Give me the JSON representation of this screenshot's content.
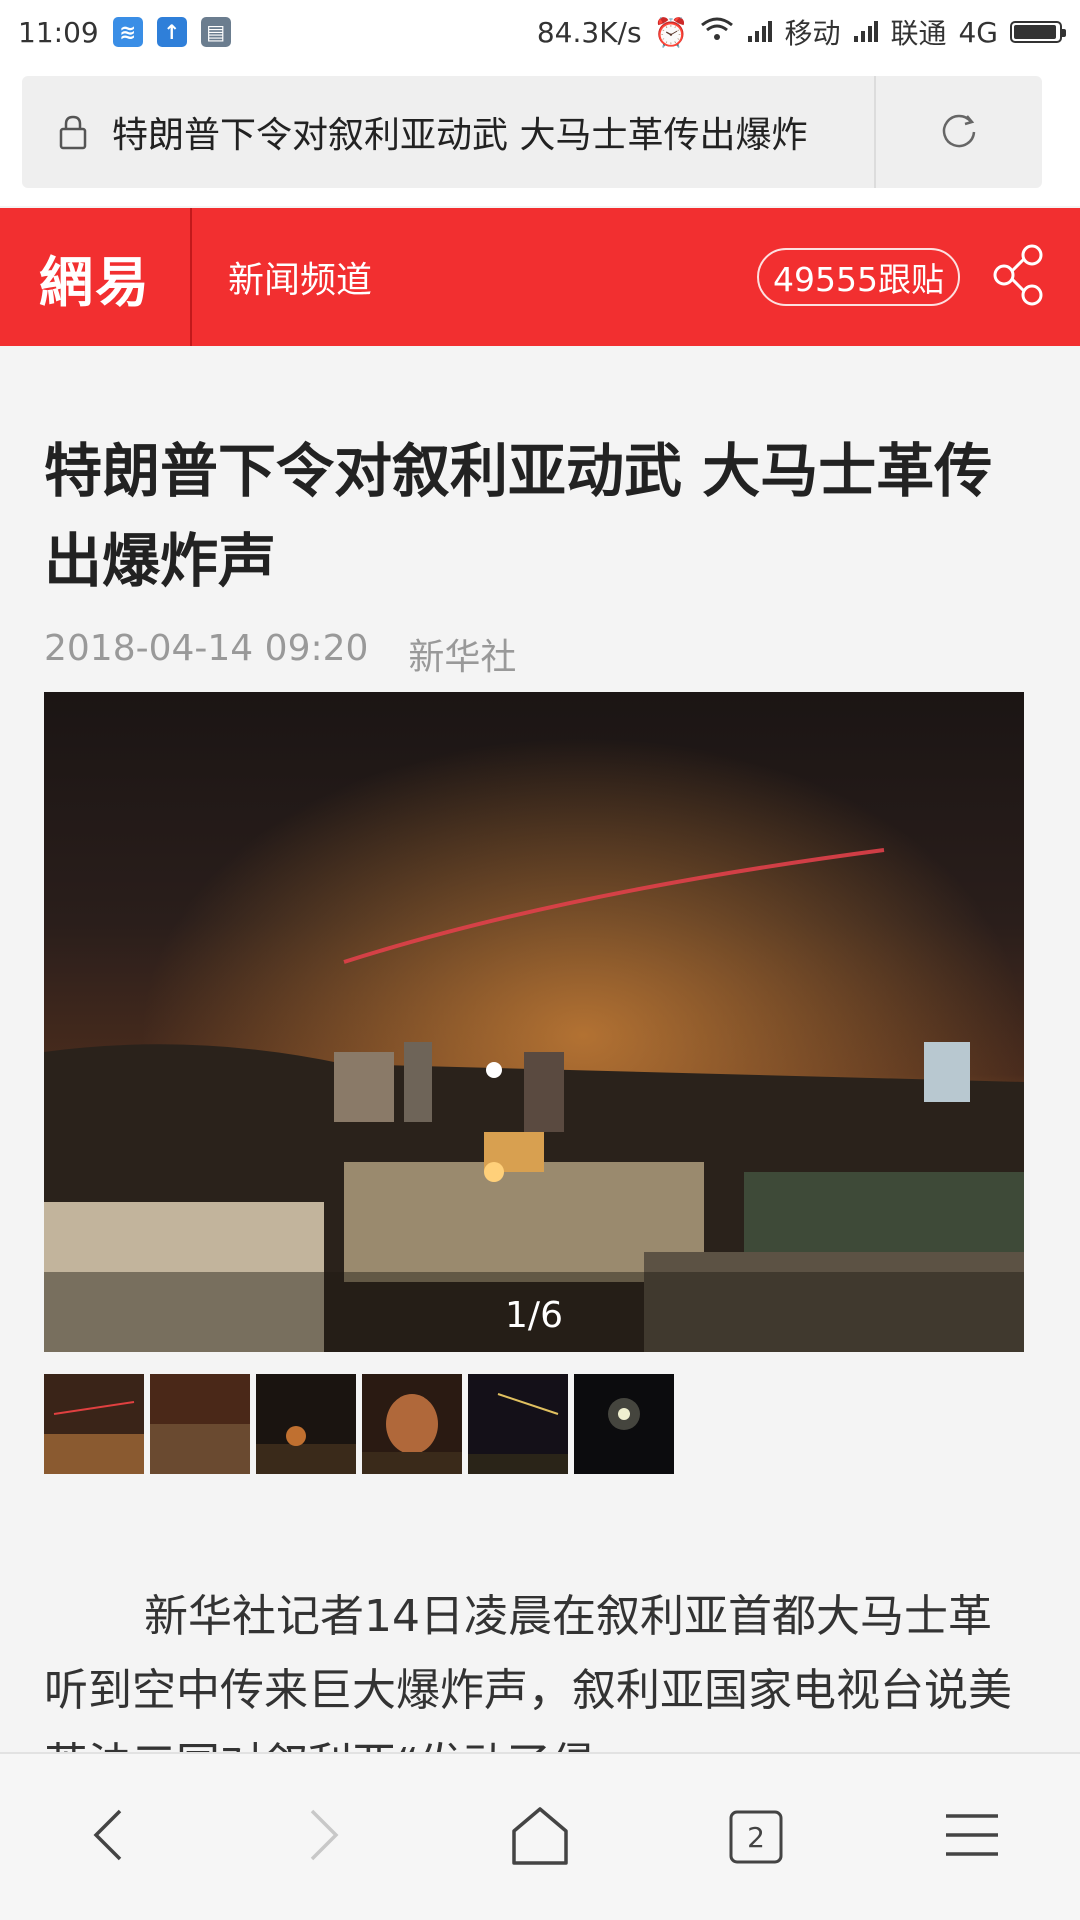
{
  "status_bar": {
    "time": "11:09",
    "speed": "84.3K/s",
    "carrier_1": "移动",
    "carrier_2": "联通",
    "network": "4G",
    "battery_level": 0.95
  },
  "address_bar": {
    "url_title": "特朗普下令对叙利亚动武 大马士革传出爆炸"
  },
  "site_header": {
    "logo": "網易",
    "channel": "新闻频道",
    "comments": "49555跟贴"
  },
  "article": {
    "title": "特朗普下令对叙利亚动武 大马士革传出爆炸声",
    "date": "2018-04-14 09:20",
    "source": "新华社",
    "gallery_counter": "1/6",
    "body": "新华社记者14日凌晨在叙利亚首都大马士革听到空中传来巨大爆炸声，叙利亚国家电视台说美英法三国对叙利亚“发动了侵"
  },
  "bottom_nav": {
    "tab_count": "2"
  },
  "colors": {
    "brand_red": "#f22f30"
  }
}
